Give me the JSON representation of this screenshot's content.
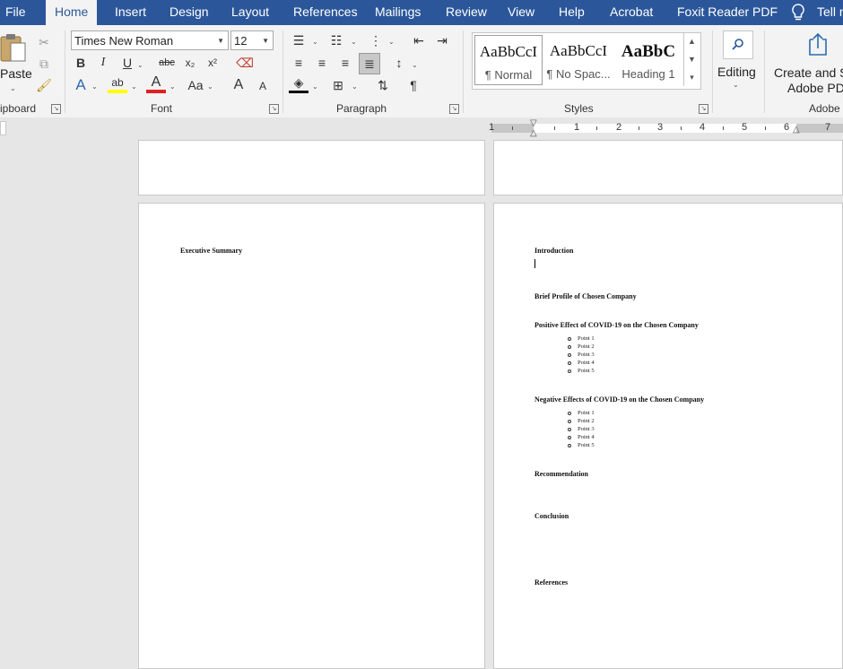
{
  "menu": {
    "tabs": [
      "File",
      "Home",
      "Insert",
      "Design",
      "Layout",
      "References",
      "Mailings",
      "Review",
      "View",
      "Help",
      "Acrobat",
      "Foxit Reader PDF"
    ],
    "tell_me": "Tell m"
  },
  "ribbon": {
    "clipboard": {
      "paste_label": "Paste",
      "group_label": "ipboard"
    },
    "font": {
      "family": "Times New Roman",
      "size": "12",
      "group_label": "Font",
      "bold": "B",
      "italic": "I",
      "underline": "U",
      "strike": "abc",
      "subscript": "x₂",
      "superscript": "x²",
      "change_case": "Aa",
      "grow": "A",
      "shrink": "A"
    },
    "paragraph": {
      "group_label": "Paragraph",
      "pilcrow": "¶"
    },
    "styles": {
      "group_label": "Styles",
      "items": [
        {
          "preview": "AaBbCcI",
          "name": "¶ Normal"
        },
        {
          "preview": "AaBbCcI",
          "name": "¶ No Spac..."
        },
        {
          "preview": "AaBbC",
          "name": "Heading 1"
        }
      ]
    },
    "editing": {
      "label": "Editing"
    },
    "adobe": {
      "line1": "Create and Sh",
      "line2": "Adobe PDF",
      "group_label": "Adobe"
    }
  },
  "ruler": {
    "numbers": [
      "1",
      "1",
      "2",
      "3",
      "4",
      "5",
      "6",
      "7"
    ]
  },
  "document": {
    "left_page": {
      "heading": "Executive Summary"
    },
    "right_page": {
      "introduction": "Introduction",
      "brief_profile": "Brief Profile of Chosen Company",
      "positive": "Positive Effect of COVID-19 on the Chosen Company",
      "positive_points": [
        "Point 1",
        "Point 2",
        "Point 3",
        "Point 4",
        "Point 5"
      ],
      "negative": "Negative Effects of COVID-19 on the Chosen Company",
      "negative_points": [
        "Point 1",
        "Point 2",
        "Point 3",
        "Point 4",
        "Point 5"
      ],
      "recommendation": "Recommendation",
      "conclusion": "Conclusion",
      "references": "References"
    }
  }
}
